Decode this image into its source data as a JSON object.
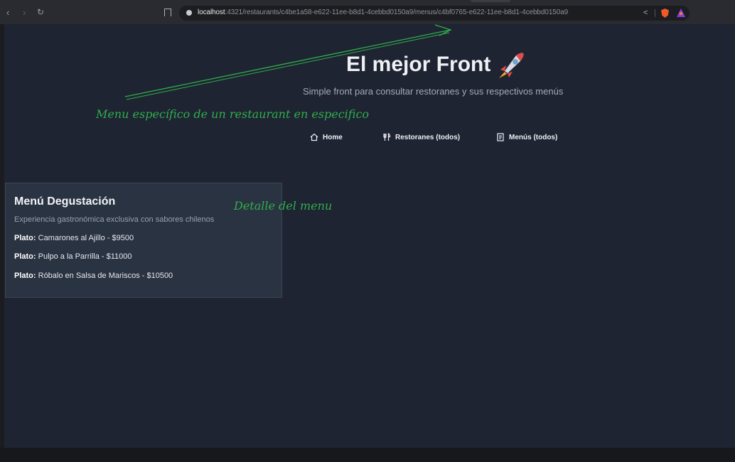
{
  "browser": {
    "back_icon": "chevron-left-icon",
    "forward_icon": "chevron-right-icon",
    "reload_icon": "reload-icon",
    "url_host": "localhost",
    "url_rest": ":4321/restaurants/c4be1a58-e622-11ee-b8d1-4cebbd0150a9/menus/c4bf0765-e622-11ee-b8d1-4cebbd0150a9"
  },
  "header": {
    "title": "El mejor Front",
    "subtitle": "Simple front para consultar restoranes y sus respectivos menús"
  },
  "nav": {
    "home": "Home",
    "restaurants": "Restoranes (todos)",
    "menus": "Menús (todos)"
  },
  "annotations": {
    "top": "Menu específico de un restaurant en especifico",
    "card": "Detalle del menu"
  },
  "menu": {
    "name": "Menú Degustación",
    "description": "Experiencia gastronómica exclusiva con sabores chilenos",
    "dish_label": "Plato:",
    "dishes": [
      " Camarones al Ajillo - $9500",
      " Pulpo a la Parrilla - $11000",
      " Róbalo en Salsa de Mariscos - $10500"
    ]
  },
  "colors": {
    "page_bg": "#1f2433",
    "card_bg": "#2a3342",
    "annotation": "#2fae4b"
  }
}
